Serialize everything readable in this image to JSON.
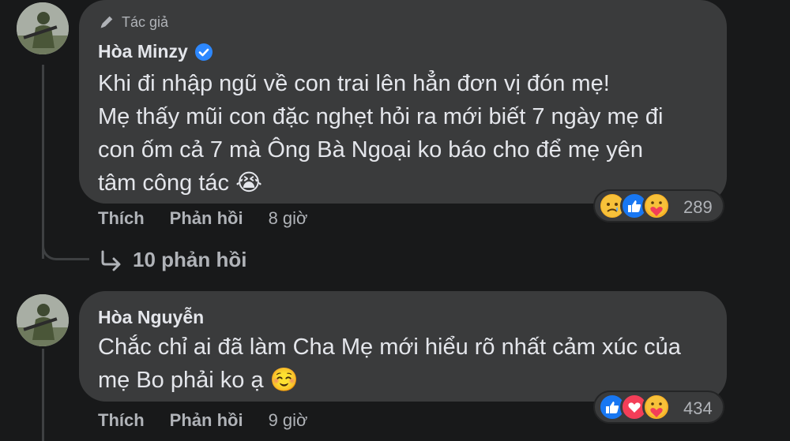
{
  "comments": [
    {
      "badge_label": "Tác giả",
      "author": "Hòa Minzy",
      "verified": true,
      "text_lines": [
        "Khi đi nhập ngũ về con trai lên hẳn đơn vị đón mẹ!",
        "Mẹ thấy mũi con đặc nghẹt hỏi ra mới biết 7 ngày mẹ đi",
        "con ốm cả 7 mà Ông Bà Ngoại ko báo cho để mẹ yên",
        "tâm công tác"
      ],
      "emoji": "😭",
      "reactions": [
        "sad",
        "like",
        "care"
      ],
      "reaction_count": "289",
      "like_label": "Thích",
      "reply_label": "Phản hồi",
      "time": "8 giờ",
      "replies_link": "10 phản hồi"
    },
    {
      "author": "Hòa Nguyễn",
      "text_lines": [
        "Chắc chỉ ai đã làm Cha Mẹ mới hiểu rõ nhất cảm xúc của",
        "mẹ Bo phải ko ạ"
      ],
      "emoji": "☺️",
      "reactions": [
        "like",
        "love",
        "care"
      ],
      "reaction_count": "434",
      "like_label": "Thích",
      "reply_label": "Phản hồi",
      "time": "9 giờ"
    }
  ],
  "colors": {
    "background": "#18191a",
    "bubble": "#3a3b3c",
    "text": "#e4e6eb",
    "muted": "#b0b3b8",
    "verified": "#2d88ff",
    "like": "#1877f2",
    "love": "#f33e58",
    "care": "#f7b125"
  }
}
